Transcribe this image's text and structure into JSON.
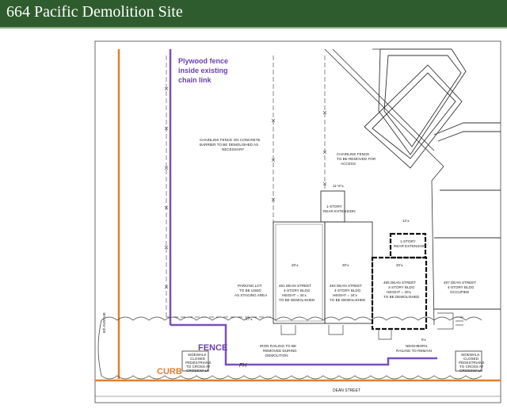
{
  "header": {
    "title": "664 Pacific Demolition Site"
  },
  "colors": {
    "header_bg": "#2f5c2e",
    "fence": "#7a4fc0",
    "curb": "#e0802a"
  },
  "labels": {
    "plywood_note_1": "Plywood fence",
    "plywood_note_2": "inside existing",
    "plywood_note_3": "chain link",
    "fence": "FENCE",
    "curb": "CURB",
    "fh": "FH",
    "chainlink_concrete_1": "CHAINLINK FENCE ON CONCRETE",
    "chainlink_concrete_2": "BARRIER TO BE DEMOLISHED AS",
    "chainlink_concrete_3": "NECESSARY",
    "chainlink_remove_1": "CHAINLINK FENCE",
    "chainlink_remove_2": "TO BE REMOVED FOR",
    "chainlink_remove_3": "ACCESS",
    "dim_11_6": "11'-6\"±",
    "rear_ext_1": "1-STORY",
    "rear_ext_2": "REAR EXTENSION",
    "dim_12": "12'±",
    "rear_ext_b_1": "1-STORY",
    "rear_ext_b_2": "REAR EXTENSION",
    "dim_20_a": "20'±",
    "dim_20_b": "20'±",
    "dim_20_c": "20'±",
    "parking_1": "PARKING LOT",
    "parking_2": "TO BE USED",
    "parking_3": "AS STAGING AREA",
    "b491_1": "491 DEAN STREET",
    "b491_2": "4-STORY BLDG",
    "b491_3": "HEIGHT = 34'±",
    "b491_4": "TO BE DEMOLISHED",
    "b493_1": "493 DEAN STREET",
    "b493_2": "4-STORY BLDG",
    "b493_3": "HEIGHT = 34'±",
    "b493_4": "TO BE DEMOLISHED",
    "b495_1": "495 DEAN STREET",
    "b495_2": "2-STORY BLDG",
    "b495_3": "HEIGHT = 20'±",
    "b495_4": "TO BE DEMOLISHED",
    "b497_1": "497 DEAN STREET",
    "b497_2": "4-STORY BLDG",
    "b497_3": "OCCUPIED",
    "dim_17": "17'±",
    "iron_1": "IRON RAILING TO BE",
    "iron_2": "REMOVED DURING",
    "iron_3": "DEMOLITION",
    "neighbor_1": "NEIGHBORS",
    "neighbor_2": "RAILING TO REMAIN",
    "sidewalk_l_1": "SIDEWALK",
    "sidewalk_l_2": "CLOSED",
    "sidewalk_l_3": "PEDESTRIANS",
    "sidewalk_l_4": "TO CROSS AT",
    "sidewalk_l_5": "CROSSWALK",
    "sidewalk_r_1": "SIDEWALK",
    "sidewalk_r_2": "CLOSED",
    "sidewalk_r_3": "PEDESTRIANS",
    "sidewalk_r_4": "TO CROSS AT",
    "sidewalk_r_5": "CROSSWALK",
    "dean_street": "DEAN STREET",
    "sixth_ave": "6th AVENUE",
    "dim_5": "5'±"
  }
}
